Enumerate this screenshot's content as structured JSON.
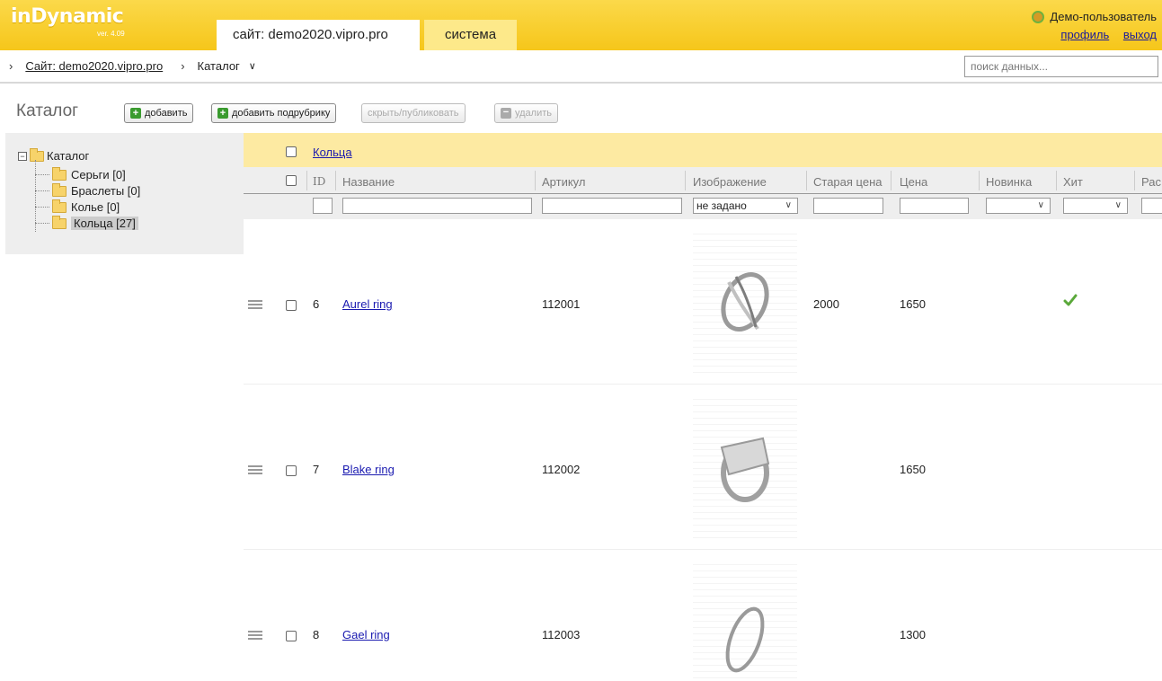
{
  "app": {
    "logo": "inDynamic",
    "version": "ver. 4.09"
  },
  "tabs": [
    {
      "label": "сайт: demo2020.vipro.pro"
    },
    {
      "label": "система"
    }
  ],
  "user": {
    "name": "Демо-пользователь",
    "profile_link": "профиль",
    "logout_link": "выход"
  },
  "breadcrumb": {
    "site": "Сайт: demo2020.vipro.pro",
    "current": "Каталог"
  },
  "search": {
    "placeholder": "поиск данных..."
  },
  "page": {
    "title": "Каталог"
  },
  "toolbar": {
    "add": "добавить",
    "add_subsection": "добавить подрубрику",
    "hide_publish": "скрыть/публиковать",
    "delete": "удалить"
  },
  "tree": {
    "root": "Каталог",
    "items": [
      "Серьги [0]",
      "Браслеты [0]",
      "Колье [0]",
      "Кольца [27]"
    ],
    "selected_index": 3
  },
  "grid": {
    "group_label": "Кольца",
    "columns": [
      "ID",
      "Название",
      "Артикул",
      "Изображение",
      "Старая цена",
      "Цена",
      "Новинка",
      "Хит",
      "Рас"
    ],
    "filters": {
      "image_select": "не задано"
    },
    "rows": [
      {
        "id": "6",
        "name": "Aurel ring",
        "article": "112001",
        "old_price": "2000",
        "price": "1650",
        "hit": true
      },
      {
        "id": "7",
        "name": "Blake ring",
        "article": "112002",
        "old_price": "",
        "price": "1650",
        "hit": false
      },
      {
        "id": "8",
        "name": "Gael ring",
        "article": "112003",
        "old_price": "",
        "price": "1300",
        "hit": false
      }
    ]
  },
  "colors": {
    "accent": "#f6c61a",
    "group_row": "#fdeaa2",
    "link": "#1a1ab0",
    "hit_check": "#5aa83a"
  }
}
